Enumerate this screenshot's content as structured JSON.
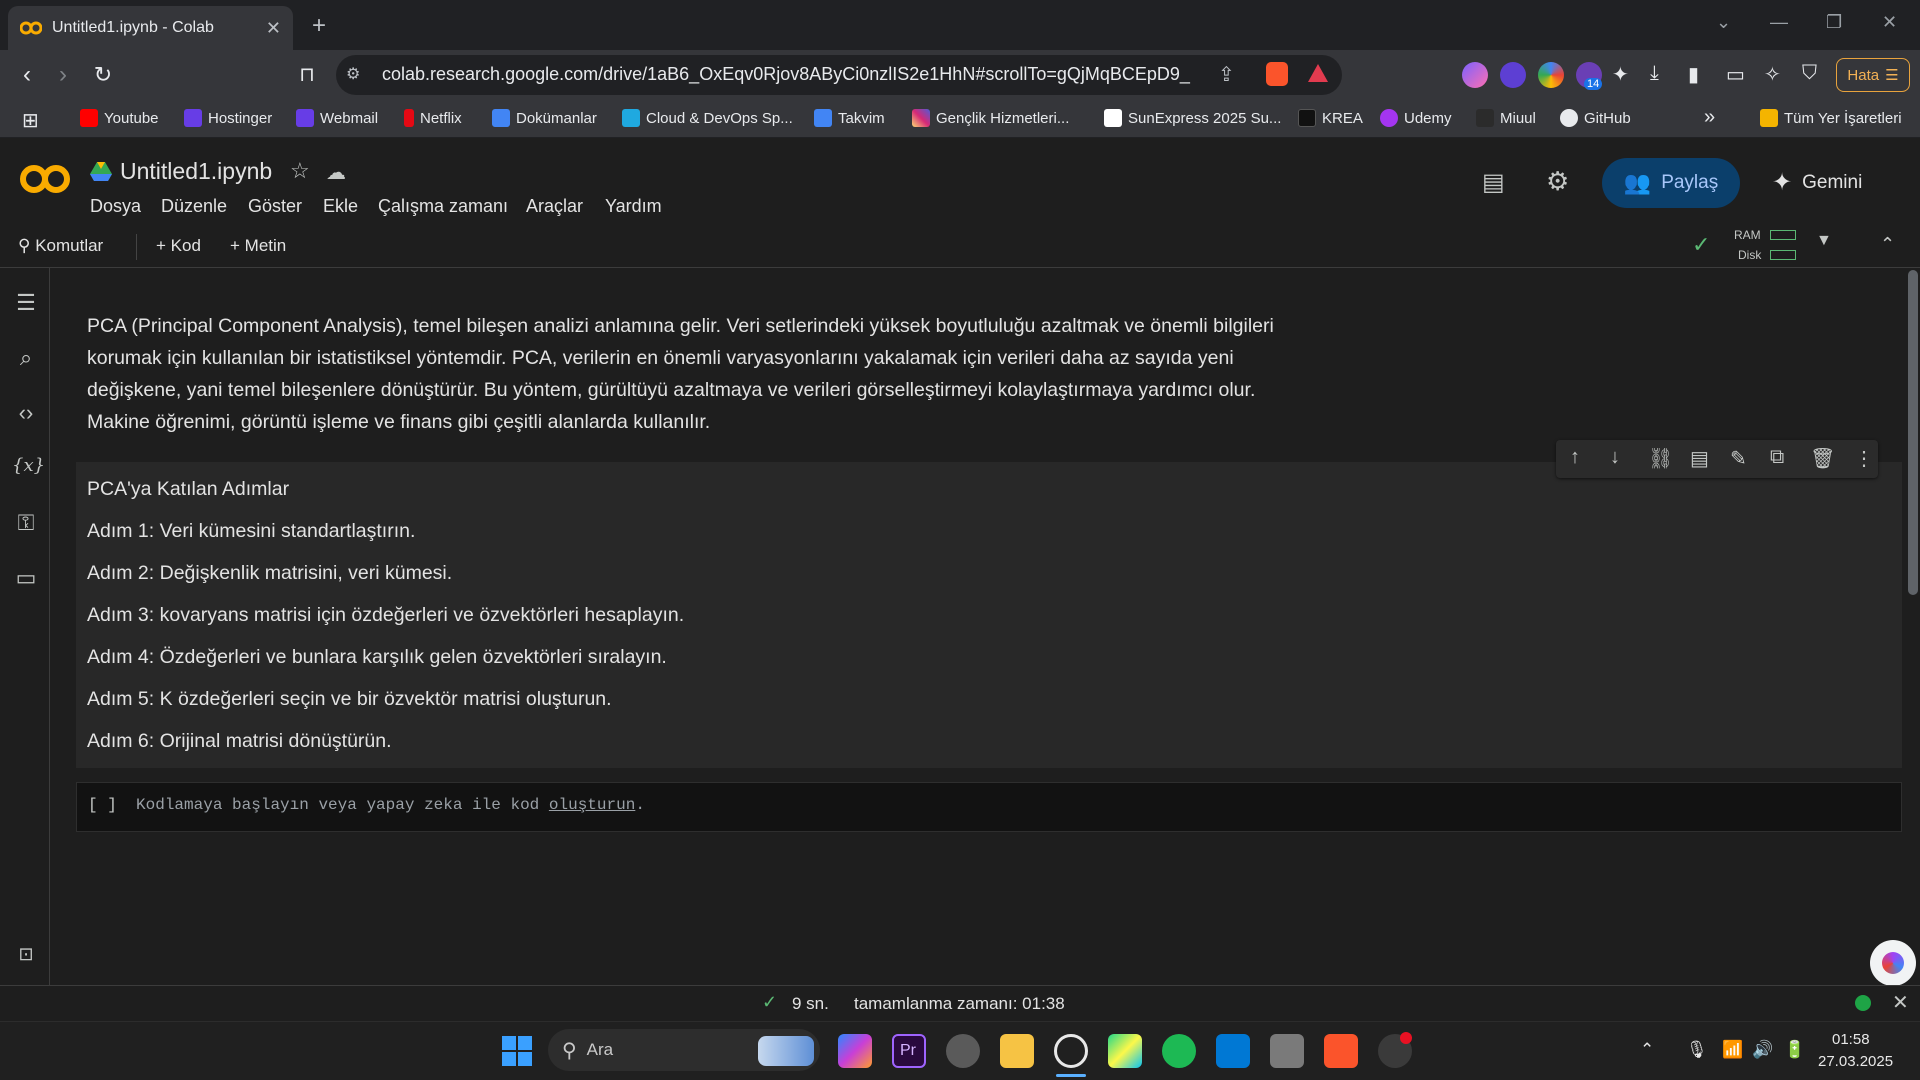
{
  "browser": {
    "tab_title": "Untitled1.ipynb - Colab",
    "url": "colab.research.google.com/drive/1aB6_OxEqv0Rjov8AByCi0nzlIS2e1HhN#scrollTo=gQjMqBCEpD9_",
    "error_button_label": "Hata",
    "extension_badge": "14",
    "bookmarks": [
      "Youtube",
      "Hostinger",
      "Webmail",
      "Netflix",
      "Dokümanlar",
      "Cloud & DevOps Sp...",
      "Takvim",
      "Gençlik Hizmetleri...",
      "SunExpress 2025 Su...",
      "KREA",
      "Udemy",
      "Miuul",
      "GitHub"
    ],
    "all_bookmarks_label": "Tüm Yer İşaretleri"
  },
  "colab": {
    "notebook_title": "Untitled1.ipynb",
    "menu": [
      "Dosya",
      "Düzenle",
      "Göster",
      "Ekle",
      "Çalışma zamanı",
      "Araçlar",
      "Yardım"
    ],
    "share_label": "Paylaş",
    "gemini_label": "Gemini",
    "toolbar": {
      "commands_label": "Komutlar",
      "code_label": "Kod",
      "text_label": "Metin",
      "ram_label": "RAM",
      "disk_label": "Disk"
    }
  },
  "content": {
    "intro_lines": [
      "PCA (Principal Component Analysis), temel bileşen analizi anlamına gelir. Veri setlerindeki yüksek boyutluluğu azaltmak ve önemli bilgileri",
      "korumak için kullanılan bir istatistiksel yöntemdir. PCA, verilerin en önemli varyasyonlarını yakalamak için verileri daha az sayıda yeni",
      "değişkene, yani temel bileşenlere dönüştürür. Bu yöntem, gürültüyü azaltmaya ve verileri görselleştirmeyi kolaylaştırmaya yardımcı olur.",
      "Makine öğrenimi, görüntü işleme ve finans gibi çeşitli alanlarda kullanılır."
    ],
    "steps_heading": "PCA'ya Katılan Adımlar",
    "steps": [
      "Adım 1: Veri kümesini standartlaştırın.",
      "Adım 2: Değişkenlik matrisini, veri kümesi.",
      "Adım 3: kovaryans matrisi için özdeğerleri ve özvektörleri hesaplayın.",
      "Adım 4: Özdeğerleri ve bunlara karşılık gelen özvektörleri sıralayın.",
      "Adım 5: K özdeğerleri seçin ve bir özvektör matrisi oluşturun.",
      "Adım 6: Orijinal matrisi dönüştürün."
    ],
    "code_cell": {
      "bracket": "[ ]",
      "placeholder_prefix": "Kodlamaya başlayın veya yapay zeka ile kod",
      "placeholder_link": "oluşturun",
      "placeholder_suffix": "."
    }
  },
  "status": {
    "duration": "9 sn.",
    "completion": "tamamlanma zamanı: 01:38"
  },
  "taskbar": {
    "search_label": "Ara",
    "time": "01:58",
    "date": "27.03.2025"
  },
  "colors": {
    "accent_orange": "#f9ab00",
    "share_bg": "#0b3f6b",
    "status_green": "#1ea446"
  }
}
